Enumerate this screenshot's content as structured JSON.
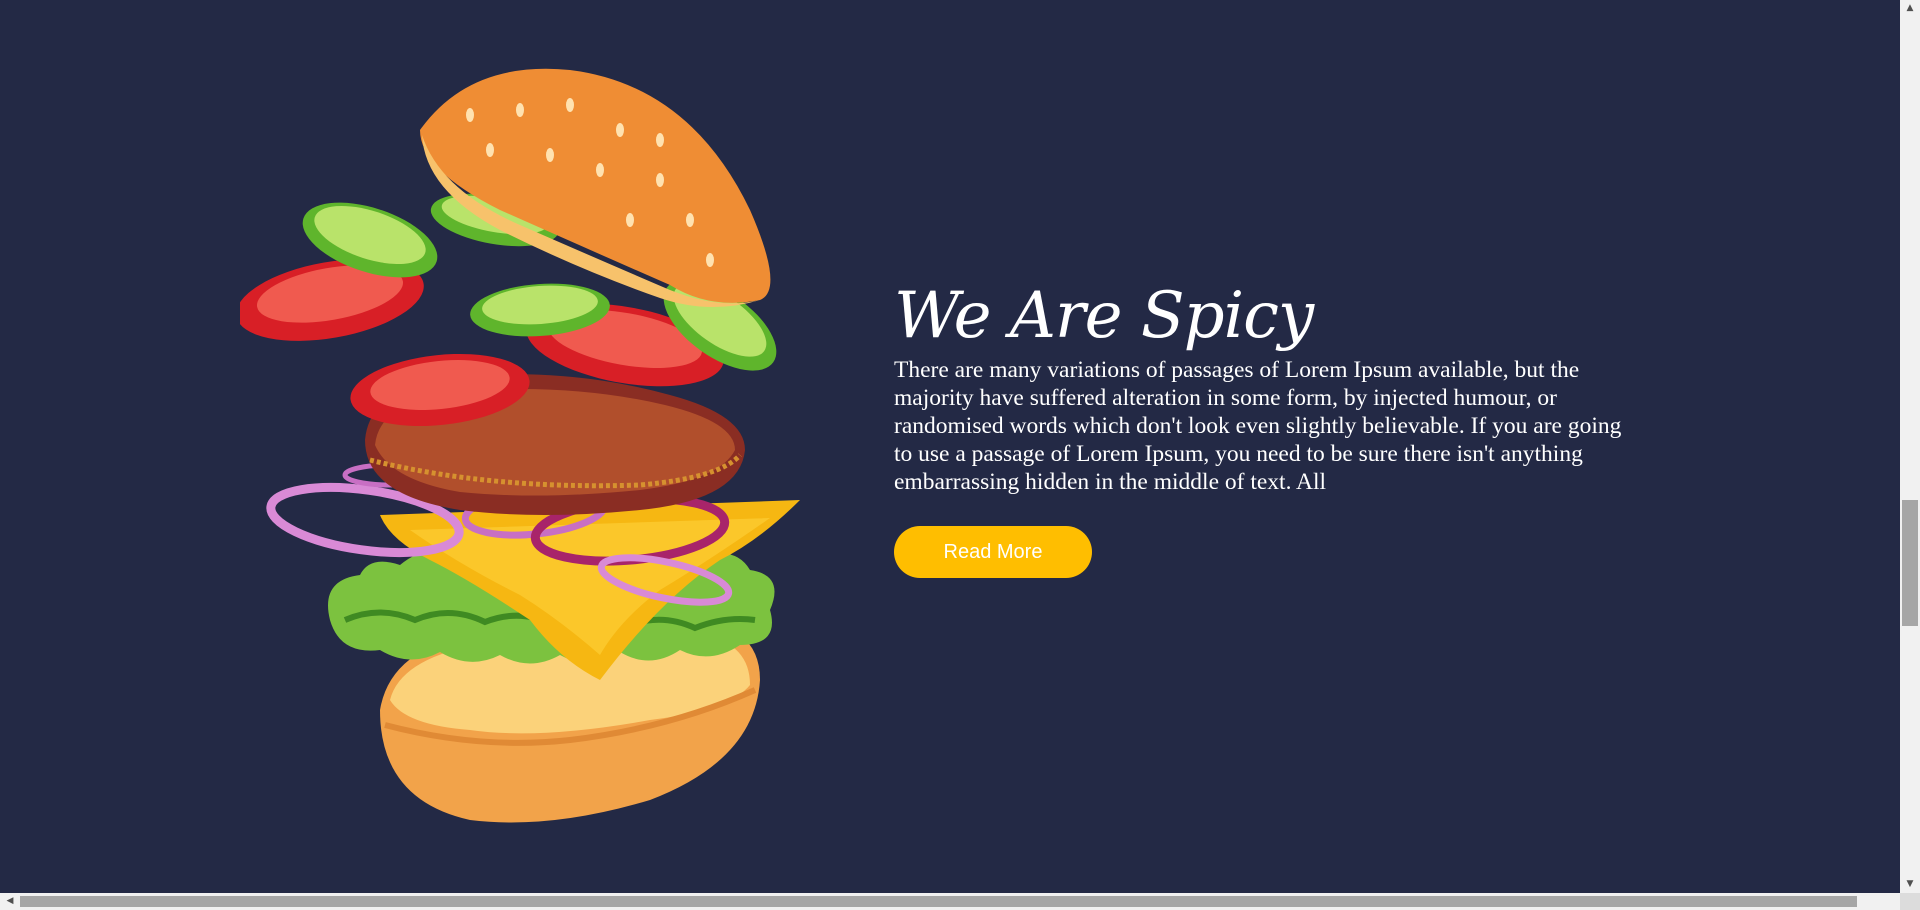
{
  "hero": {
    "title": "We Are Spicy",
    "description": "There are many variations of passages of Lorem Ipsum available, but the majority have suffered alteration in some form, by injected humour, or randomised words which don't look even slightly believable. If you are going to use a passage of Lorem Ipsum, you need to be sure there isn't anything embarrassing hidden in the middle of text. All",
    "button_label": "Read More",
    "image": "exploded-burger-illustration"
  },
  "colors": {
    "background": "#232945",
    "accent": "#ffbe00",
    "text": "#ffffff"
  },
  "scrollbars": {
    "up_arrow": "▲",
    "down_arrow": "▼",
    "left_arrow": "◀",
    "right_arrow": "▶"
  }
}
